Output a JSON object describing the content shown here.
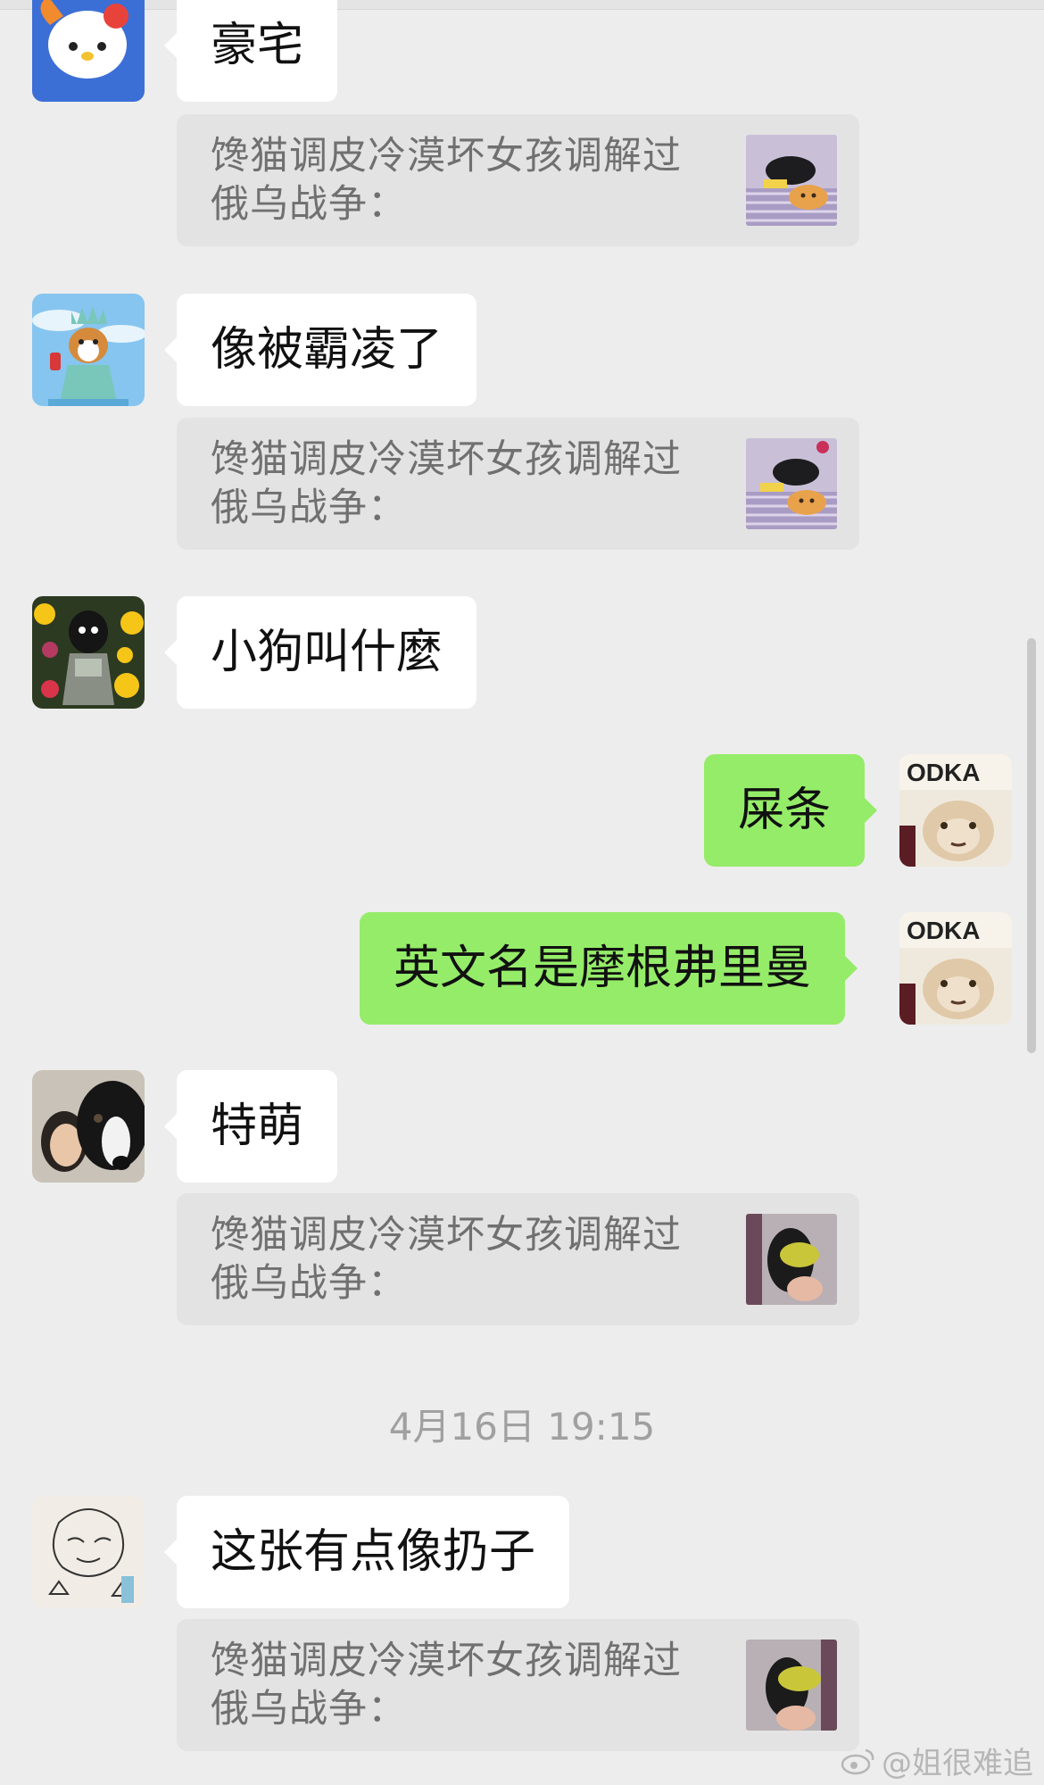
{
  "messages": [
    {
      "text": "豪宅",
      "quote": "馋猫调皮冷漠坏女孩调解过俄乌战争："
    },
    {
      "text": "像被霸凌了",
      "quote": "馋猫调皮冷漠坏女孩调解过俄乌战争："
    },
    {
      "text": "小狗叫什麼"
    },
    {
      "text": "屎条"
    },
    {
      "text": "英文名是摩根弗里曼"
    },
    {
      "text": "特萌",
      "quote": "馋猫调皮冷漠坏女孩调解过俄乌战争："
    },
    {
      "text": "这张有点像扔子",
      "quote": "馋猫调皮冷漠坏女孩调解过俄乌战争："
    }
  ],
  "timestamp": "4月16日 19:15",
  "avatar_text": "ODKA",
  "watermark": "@姐很难追",
  "colors": {
    "background": "#ededed",
    "incoming": "#ffffff",
    "outgoing": "#95ec69",
    "quote": "#e3e3e3"
  }
}
